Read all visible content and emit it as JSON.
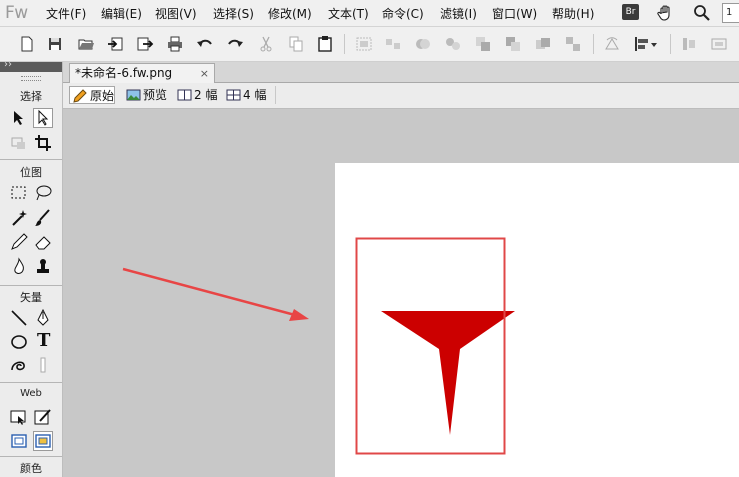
{
  "app": {
    "logo": "Fw"
  },
  "menu": [
    {
      "label": "文件(F)"
    },
    {
      "label": "编辑(E)"
    },
    {
      "label": "视图(V)"
    },
    {
      "label": "选择(S)"
    },
    {
      "label": "修改(M)"
    },
    {
      "label": "文本(T)"
    },
    {
      "label": "命令(C)"
    },
    {
      "label": "滤镜(I)"
    },
    {
      "label": "窗口(W)"
    },
    {
      "label": "帮助(H)"
    }
  ],
  "menu_right": {
    "bridge_badge": "Br",
    "zoom_value": "1"
  },
  "document": {
    "tab_title": "*未命名-6.fw.png",
    "close_glyph": "×"
  },
  "view_modes": [
    {
      "label": "原始",
      "icon": "pencil-icon",
      "active": true
    },
    {
      "label": "预览",
      "icon": "image-preview-icon",
      "active": false
    },
    {
      "label": "2 幅",
      "icon": "two-up-icon",
      "active": false
    },
    {
      "label": "4 幅",
      "icon": "four-up-icon",
      "active": false
    }
  ],
  "tools_panel": {
    "collapse_glyph": "››",
    "sections": [
      {
        "label": "选择"
      },
      {
        "label": "位图"
      },
      {
        "label": "矢量"
      },
      {
        "label": "Web"
      },
      {
        "label": "颜色"
      }
    ],
    "text_tool_glyph": "T"
  },
  "colors": {
    "funnel_red": "#cc0000",
    "selection_rect": "#e04848",
    "arrow": "#e84545",
    "canvas_bg": "#c8c8c8",
    "panel_bg": "#ececec"
  }
}
